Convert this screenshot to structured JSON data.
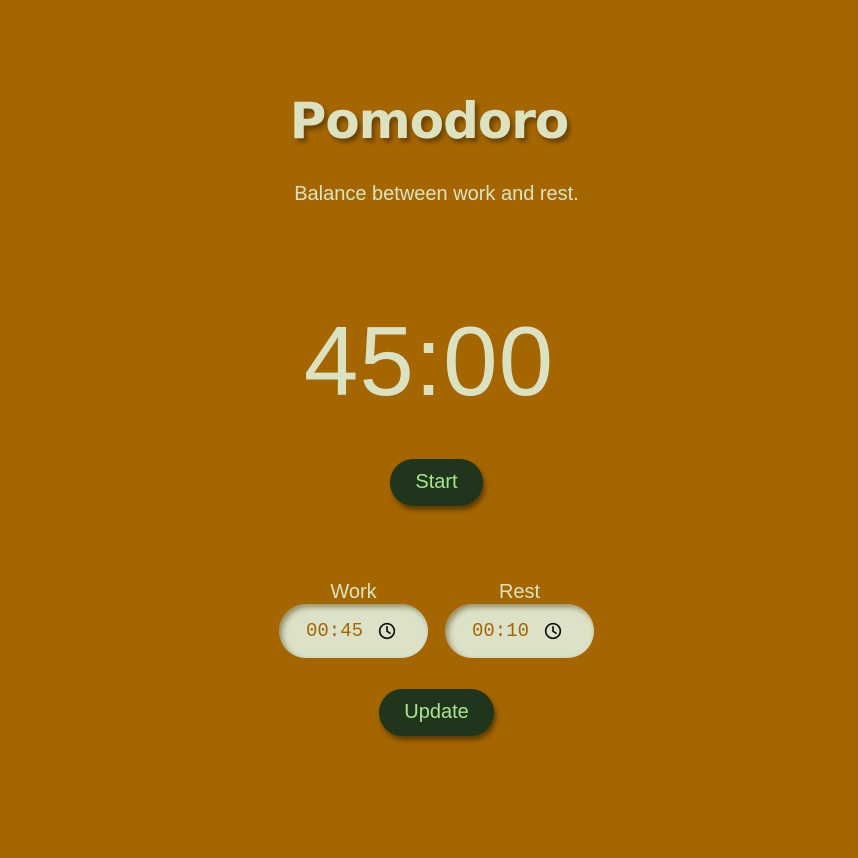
{
  "app": {
    "title": "Pomodoro",
    "subtitle": "Balance between work and rest."
  },
  "timer": {
    "display": "45:00"
  },
  "controls": {
    "start_label": "Start",
    "update_label": "Update"
  },
  "settings": {
    "work": {
      "label": "Work",
      "value": "00:45",
      "icon": "clock-icon"
    },
    "rest": {
      "label": "Rest",
      "value": "00:10",
      "icon": "clock-icon"
    }
  },
  "colors": {
    "background": "#a56600",
    "text": "#dbe2c2",
    "button_bg": "#1f361c",
    "button_text": "#a9e48a",
    "input_bg": "#dbe2c8"
  }
}
